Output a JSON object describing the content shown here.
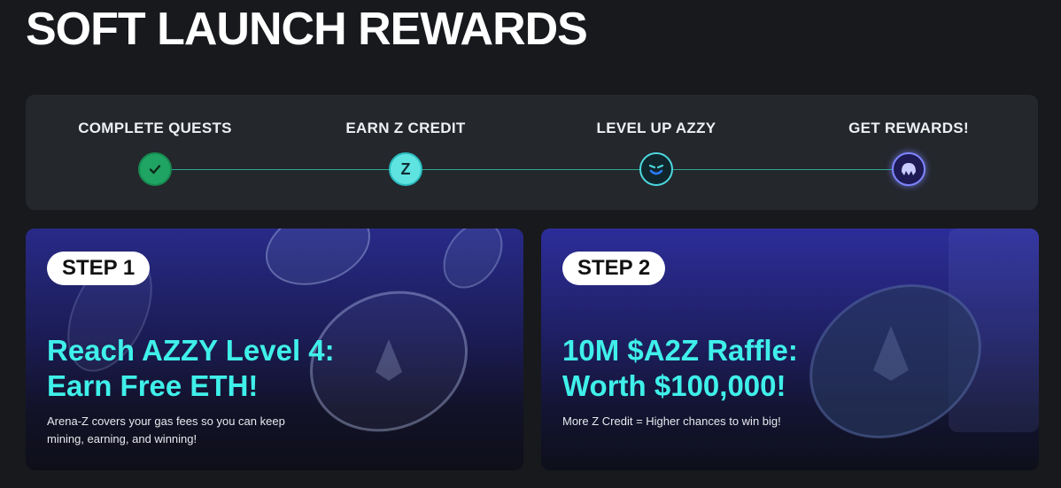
{
  "page_title": "SOFT LAUNCH REWARDS",
  "steps": [
    {
      "label": "COMPLETE QUESTS",
      "icon": "check-icon",
      "color": "#1fa463"
    },
    {
      "label": "EARN Z CREDIT",
      "icon": "z-credit-icon",
      "glyph": "Z",
      "color": "#5fe3e0"
    },
    {
      "label": "LEVEL UP AZZY",
      "icon": "azzy-face-icon",
      "color": "#4dd8e0"
    },
    {
      "label": "GET REWARDS!",
      "icon": "reward-icon",
      "color": "#7f86ff"
    }
  ],
  "cards": [
    {
      "badge": "STEP 1",
      "headline_line1": "Reach AZZY Level 4:",
      "headline_line2": "Earn Free ETH!",
      "description": "Arena-Z covers your gas fees so you can keep mining, earning, and winning!"
    },
    {
      "badge": "STEP 2",
      "headline_line1": "10M $A2Z Raffle:",
      "headline_line2": "Worth $100,000!",
      "description": "More Z Credit = Higher chances to win big!"
    }
  ],
  "colors": {
    "background": "#17191d",
    "panel": "#24272c",
    "accent_cyan": "#3ff0ea",
    "track": "#2aa88f"
  }
}
